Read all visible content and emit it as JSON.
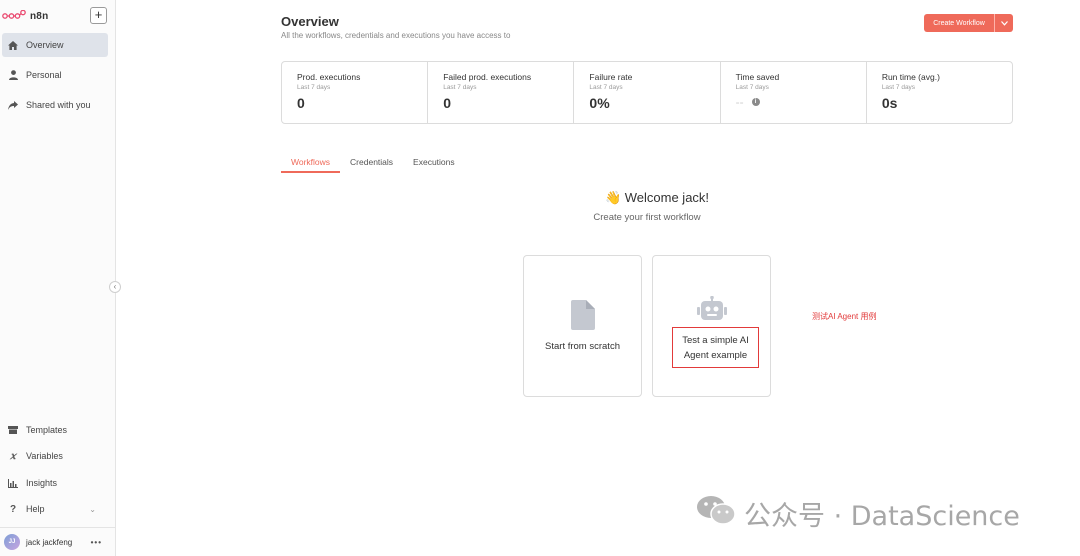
{
  "sidebar": {
    "logo_text": "n8n",
    "add_label": "+",
    "collapse_label": "‹",
    "nav": [
      {
        "label": "Overview",
        "icon": "home-icon",
        "active": true
      },
      {
        "label": "Personal",
        "icon": "user-icon",
        "active": false
      },
      {
        "label": "Shared with you",
        "icon": "share-icon",
        "active": false
      }
    ],
    "bottom": [
      {
        "label": "Templates",
        "icon": "box-icon"
      },
      {
        "label": "Variables",
        "icon": "variable-icon"
      },
      {
        "label": "Insights",
        "icon": "chart-icon"
      },
      {
        "label": "Help",
        "icon": "question-icon"
      }
    ],
    "user": {
      "initials": "JJ",
      "name": "jack jackfeng",
      "more": "•••"
    }
  },
  "header": {
    "title": "Overview",
    "subtitle": "All the workflows, credentials and executions you have access to",
    "create_button": "Create Workflow"
  },
  "stats": [
    {
      "label": "Prod. executions",
      "period": "Last 7 days",
      "value": "0"
    },
    {
      "label": "Failed prod. executions",
      "period": "Last 7 days",
      "value": "0"
    },
    {
      "label": "Failure rate",
      "period": "Last 7 days",
      "value": "0%"
    },
    {
      "label": "Time saved",
      "period": "Last 7 days",
      "value": "--"
    },
    {
      "label": "Run time (avg.)",
      "period": "Last 7 days",
      "value": "0s"
    }
  ],
  "tabs": [
    {
      "label": "Workflows",
      "active": true
    },
    {
      "label": "Credentials",
      "active": false
    },
    {
      "label": "Executions",
      "active": false
    }
  ],
  "welcome": {
    "greeting": "👋 Welcome jack!",
    "sub": "Create your first workflow"
  },
  "cards": [
    {
      "label": "Start from scratch",
      "icon": "file-icon"
    },
    {
      "label": "Test a simple AI Agent example",
      "icon": "robot-icon"
    }
  ],
  "annotation": "测试AI Agent 用例",
  "watermark": "公众号 · DataScience",
  "colors": {
    "accent": "#ef6a5a",
    "annotation": "#e23a3a"
  }
}
